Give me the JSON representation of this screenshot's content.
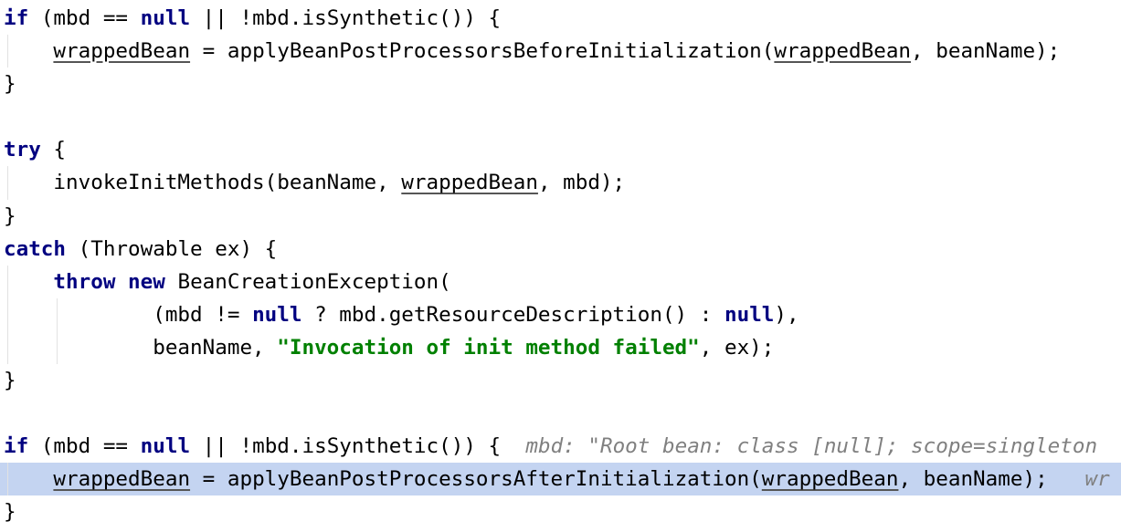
{
  "editor": {
    "highlight_color": "#c4d4f1",
    "keyword_color": "#000080",
    "string_color": "#008000",
    "hint_color": "#808080",
    "highlighted_line": 14,
    "lines": [
      {
        "guides": [],
        "tokens": [
          {
            "t": "if",
            "c": "kw"
          },
          {
            "t": " (mbd == "
          },
          {
            "t": "null",
            "c": "kw"
          },
          {
            "t": " || !mbd.isSynthetic()) {"
          }
        ]
      },
      {
        "guides": [
          0
        ],
        "tokens": [
          {
            "t": "    "
          },
          {
            "t": "wrappedBean",
            "c": "ul"
          },
          {
            "t": " = applyBeanPostProcessorsBeforeInitialization("
          },
          {
            "t": "wrappedBean",
            "c": "ul"
          },
          {
            "t": ", beanName);"
          }
        ]
      },
      {
        "guides": [],
        "tokens": [
          {
            "t": "}"
          }
        ]
      },
      {
        "guides": [],
        "tokens": []
      },
      {
        "guides": [],
        "tokens": [
          {
            "t": "try",
            "c": "kw"
          },
          {
            "t": " {"
          }
        ]
      },
      {
        "guides": [
          0
        ],
        "tokens": [
          {
            "t": "    invokeInitMethods(beanName, "
          },
          {
            "t": "wrappedBean",
            "c": "ul"
          },
          {
            "t": ", mbd);"
          }
        ]
      },
      {
        "guides": [],
        "tokens": [
          {
            "t": "}"
          }
        ]
      },
      {
        "guides": [],
        "tokens": [
          {
            "t": "catch",
            "c": "kw"
          },
          {
            "t": " (Throwable ex) {"
          }
        ]
      },
      {
        "guides": [
          0
        ],
        "tokens": [
          {
            "t": "    "
          },
          {
            "t": "throw new",
            "c": "kw"
          },
          {
            "t": " BeanCreationException("
          }
        ]
      },
      {
        "guides": [
          0,
          4
        ],
        "tokens": [
          {
            "t": "            (mbd != "
          },
          {
            "t": "null",
            "c": "kw"
          },
          {
            "t": " ? mbd.getResourceDescription() : "
          },
          {
            "t": "null",
            "c": "kw"
          },
          {
            "t": "),"
          }
        ]
      },
      {
        "guides": [
          0,
          4
        ],
        "tokens": [
          {
            "t": "            beanName, "
          },
          {
            "t": "\"Invocation of init method failed\"",
            "c": "str"
          },
          {
            "t": ", ex);"
          }
        ]
      },
      {
        "guides": [],
        "tokens": [
          {
            "t": "}"
          }
        ]
      },
      {
        "guides": [],
        "tokens": []
      },
      {
        "guides": [],
        "tokens": [
          {
            "t": "if",
            "c": "kw"
          },
          {
            "t": " (mbd == "
          },
          {
            "t": "null",
            "c": "kw"
          },
          {
            "t": " || !mbd.isSynthetic()) {"
          },
          {
            "t": "  mbd: \"Root bean: class [null]; scope=singleton",
            "c": "hint"
          }
        ]
      },
      {
        "guides": [
          0
        ],
        "tokens": [
          {
            "t": "    "
          },
          {
            "t": "wrappedBean",
            "c": "ul"
          },
          {
            "t": " = applyBeanPostProcessorsAfterInitialization("
          },
          {
            "t": "wrappedBean",
            "c": "ul"
          },
          {
            "t": ", beanName);"
          },
          {
            "t": "   wr",
            "c": "hint"
          }
        ]
      },
      {
        "guides": [],
        "tokens": [
          {
            "t": "}"
          }
        ]
      }
    ]
  }
}
